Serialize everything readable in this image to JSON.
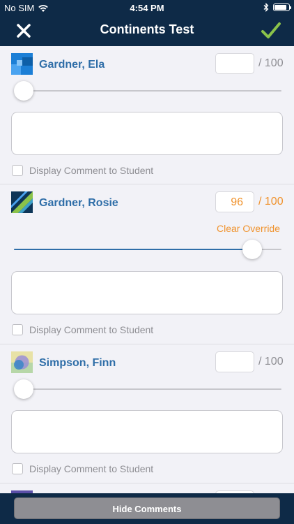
{
  "status": {
    "carrier": "No SIM",
    "time": "4:54 PM"
  },
  "nav": {
    "title": "Continents Test"
  },
  "students": [
    {
      "name": "Gardner, Ela",
      "score": "",
      "out_of": "/ 100",
      "slider_fraction": 0.0,
      "comment_checkbox_label": "Display Comment to Student"
    },
    {
      "name": "Gardner, Rosie",
      "score": "96",
      "out_of": "/ 100",
      "clear_label": "Clear Override",
      "slider_fraction": 0.96,
      "comment_checkbox_label": "Display Comment to Student"
    },
    {
      "name": "Simpson, Finn",
      "score": "",
      "out_of": "/ 100",
      "slider_fraction": 0.0,
      "comment_checkbox_label": "Display Comment to Student"
    }
  ],
  "bottom": {
    "hide_comments_label": "Hide Comments"
  },
  "colors": {
    "navbar": "#0e2a47",
    "name": "#2f6ea8",
    "override": "#f0922c",
    "check": "#8bc34a"
  }
}
